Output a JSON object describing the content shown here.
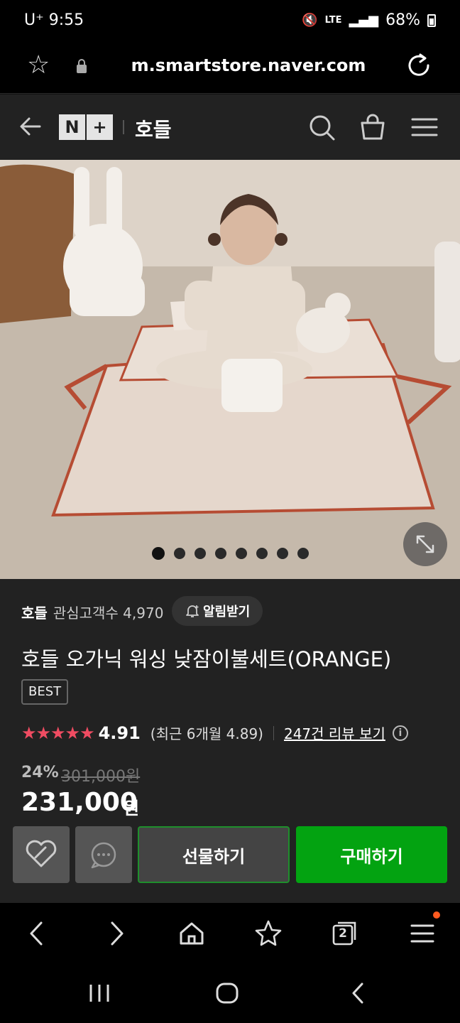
{
  "status_bar": {
    "carrier_time": "U⁺ 9:55",
    "network": "LTE",
    "battery": "68%"
  },
  "browser": {
    "url": "m.smartstore.naver.com",
    "tab_count": "2"
  },
  "header": {
    "logo_n": "N",
    "logo_plus": "+",
    "store_name": "호들"
  },
  "gallery": {
    "image_count": 8,
    "active_index": 0
  },
  "store": {
    "name": "호들",
    "followers": "관심고객수 4,970",
    "alarm_label": "알림받기"
  },
  "product": {
    "title": "호들 오가닉 워싱 낮잠이불세트(ORANGE)",
    "badge": "BEST",
    "stars": "★★★★★",
    "rating": "4.91",
    "recent_rating": "(최근 6개월 4.89)",
    "reviews_link": "247건 리뷰 보기",
    "info_symbol": "i",
    "discount": "24%",
    "original_price": "301,000원",
    "price": "231,000",
    "currency": "원"
  },
  "actions": {
    "gift_label": "선물하기",
    "buy_label": "구매하기"
  },
  "colors": {
    "buy_green": "#03a311",
    "star_red": "#f04c62",
    "header_bg": "#222222"
  }
}
